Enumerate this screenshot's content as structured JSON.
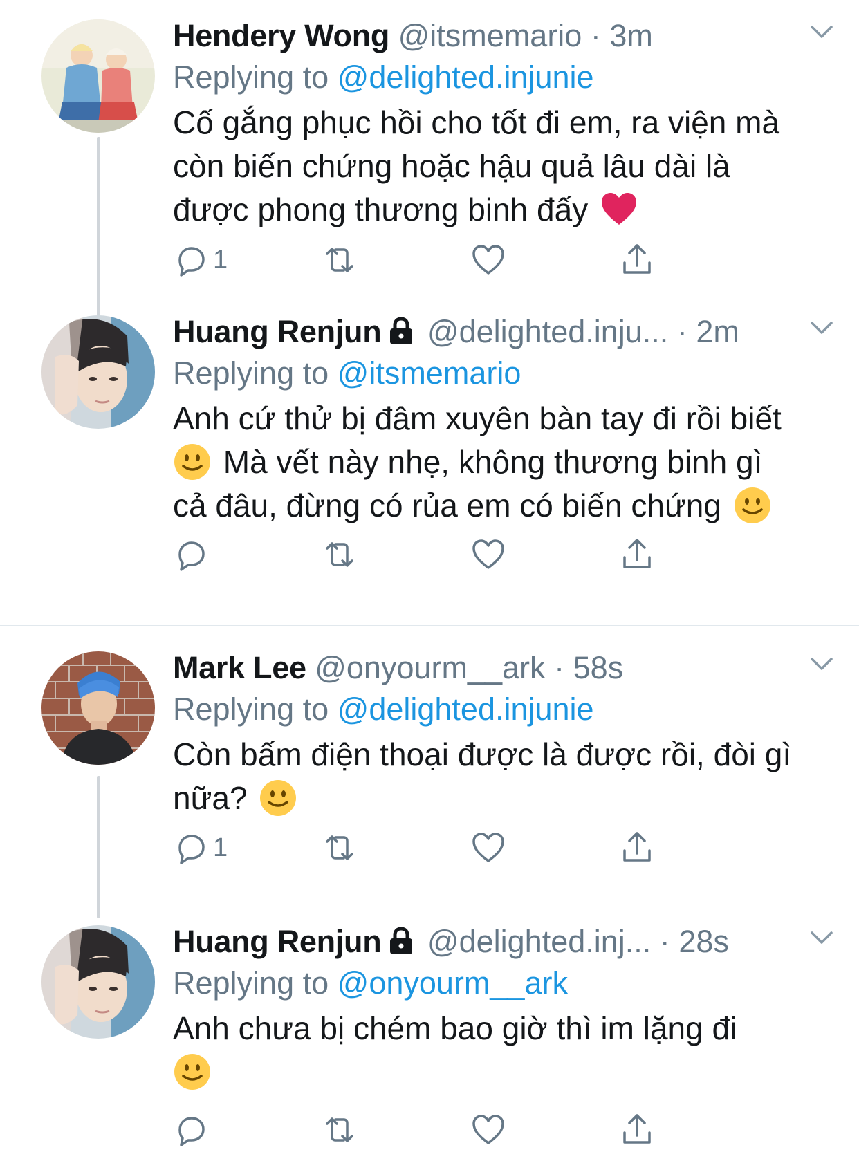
{
  "colors": {
    "link": "#1b95e0",
    "muted": "#657786",
    "text": "#14171a",
    "heart_emoji": "#e0245e",
    "smile_emoji": "#ffcc4d"
  },
  "tweets": [
    {
      "name": "Hendery Wong",
      "handle": "@itsmemario",
      "dot": "·",
      "time": "3m",
      "locked": false,
      "replying_prefix": "Replying to ",
      "replying_to": "@delighted.injunie",
      "text_lines": [
        "Cố gắng phục hồi cho tốt đi em, ra viện mà",
        "còn biến chứng hoặc hậu quả lâu dài là",
        "được phong thương binh đấy"
      ],
      "reply_count": "1",
      "avatar_icon": "avatar-photo-two-people"
    },
    {
      "name": "Huang Renjun",
      "handle": "@delighted.inju...",
      "dot": "·",
      "time": "2m",
      "locked": true,
      "replying_prefix": "Replying to ",
      "replying_to": "@itsmemario",
      "text_lines": [
        "Anh cứ thử bị đâm xuyên bàn tay đi rồi biết",
        "Mà vết này nhẹ, không thương binh gì",
        "cả đâu, đừng có rủa em có biến chứng"
      ],
      "reply_count": "",
      "avatar_icon": "avatar-photo-portrait"
    },
    {
      "name": "Mark Lee",
      "handle": "@onyourm__ark",
      "dot": "·",
      "time": "58s",
      "locked": false,
      "replying_prefix": "Replying to ",
      "replying_to": "@delighted.injunie",
      "text_lines": [
        "Còn bấm điện thoại được là được rồi, đòi gì",
        "nữa?"
      ],
      "reply_count": "1",
      "avatar_icon": "avatar-photo-blue-hair"
    },
    {
      "name": "Huang Renjun",
      "handle": "@delighted.inj...",
      "dot": "·",
      "time": "28s",
      "locked": true,
      "replying_prefix": "Replying to ",
      "replying_to": "@onyourm__ark",
      "text_lines": [
        "Anh chưa bị chém bao giờ thì im lặng đi",
        ""
      ],
      "reply_count": "",
      "avatar_icon": "avatar-photo-portrait"
    }
  ]
}
